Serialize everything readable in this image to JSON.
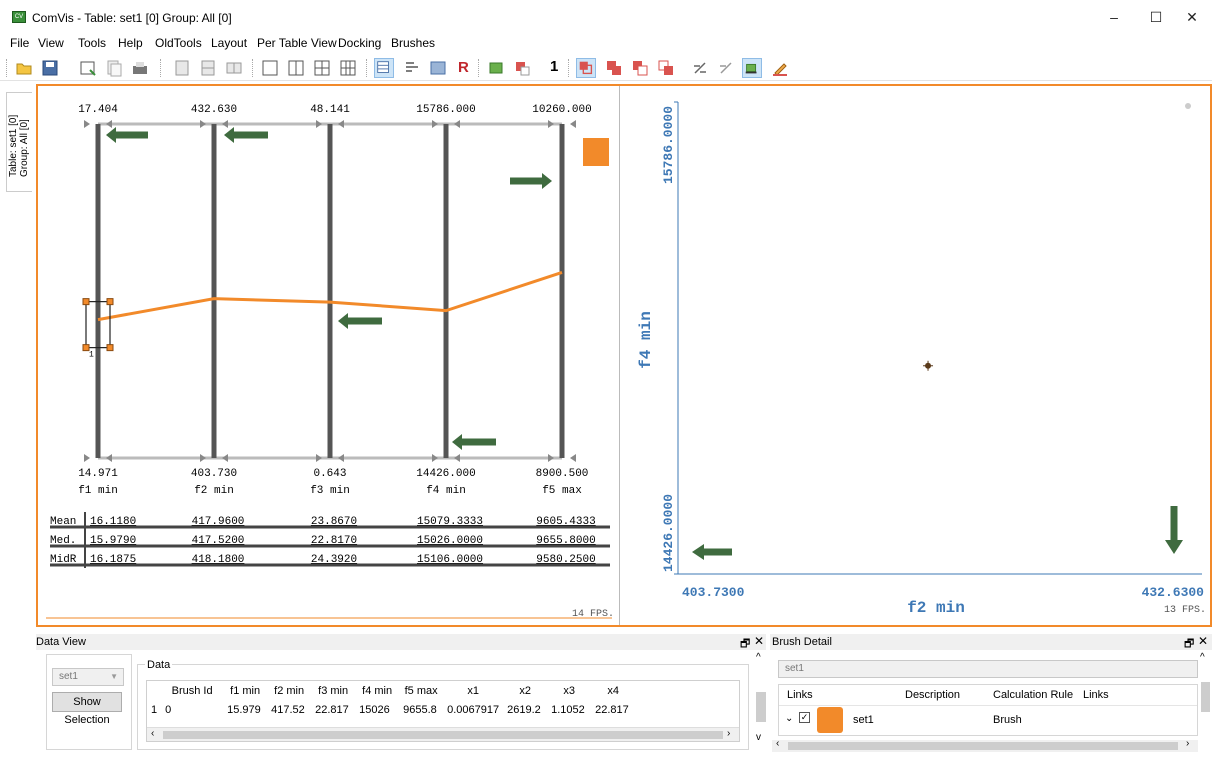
{
  "window": {
    "title": "ComVis - Table: set1 [0] Group: All [0]",
    "icon_text": "CV",
    "minimize": "–",
    "maximize": "☐",
    "close": "✕"
  },
  "menu": [
    "File",
    "View",
    "Tools",
    "Help",
    "OldTools",
    "Layout",
    "Per Table View",
    "Docking",
    "Brushes"
  ],
  "toolbar": {
    "r_label": "R",
    "one_label": "1",
    "icons": [
      "open-icon",
      "save-icon",
      "new-view-icon",
      "copy-icon",
      "print-icon",
      "layout-a-icon",
      "layout-b-icon",
      "layout-c-icon",
      "single-view-icon",
      "split-vertical-icon",
      "grid-four-icon",
      "grid-six-icon",
      "table-view-icon",
      "text-view-icon",
      "screenshot-icon",
      "r-icon",
      "plugin-icon",
      "brush-add-icon",
      "one-icon",
      "brush-and-icon",
      "brush-or-icon",
      "brush-xor-icon",
      "brush-not-icon",
      "brush-link-icon",
      "brush-unlink-icon",
      "clear-brush-icon",
      "brush-color-icon"
    ]
  },
  "sidetab": {
    "line1": "Table: set1 [0]",
    "line2": "Group: All [0]"
  },
  "parallel_coords": {
    "axes": [
      {
        "name": "f1 min",
        "max": "17.404",
        "min": "14.971"
      },
      {
        "name": "f2 min",
        "max": "432.630",
        "min": "403.730"
      },
      {
        "name": "f3 min",
        "max": "48.141",
        "min": "0.643"
      },
      {
        "name": "f4 min",
        "max": "15786.000",
        "min": "14426.000"
      },
      {
        "name": "f5 max",
        "max": "10260.000",
        "min": "8900.500"
      }
    ],
    "line_values": [
      15.979,
      417.52,
      22.817,
      15026,
      9655.8
    ],
    "brush_label": "1",
    "line_color": "#f28a2a",
    "stats": [
      {
        "label": "Mean",
        "values": [
          "16.1180",
          "417.9600",
          "23.8670",
          "15079.3333",
          "9605.4333"
        ]
      },
      {
        "label": "Med.",
        "values": [
          "15.9790",
          "417.5200",
          "22.8170",
          "15026.0000",
          "9655.8000"
        ]
      },
      {
        "label": "MidR",
        "values": [
          "16.1875",
          "418.1800",
          "24.3920",
          "15106.0000",
          "9580.2500"
        ]
      }
    ],
    "fps": "14 FPS."
  },
  "scatter": {
    "chart_data": {
      "type": "scatter",
      "xlabel": "f2 min",
      "ylabel": "f4 min",
      "xlim": [
        403.73,
        432.63
      ],
      "ylim": [
        14426,
        15786
      ],
      "x_tick_min": "403.7300",
      "x_tick_max": "432.6300",
      "y_tick_min": "14426.0000",
      "y_tick_max": "15786.0000",
      "points": [
        {
          "x": 417.52,
          "y": 15026
        }
      ]
    },
    "fps": "13 FPS."
  },
  "data_view": {
    "title": "Data View",
    "table_select": "set1",
    "show_selection": "Show Selection",
    "group_label": "Data",
    "columns": [
      "Brush Id",
      "f1 min",
      "f2 min",
      "f3 min",
      "f4 min",
      "f5 max",
      "x1",
      "x2",
      "x3",
      "x4"
    ],
    "rows": [
      {
        "index": "1",
        "cells": [
          "0",
          "15.979",
          "417.52",
          "22.817",
          "15026",
          "9655.8",
          "0.0067917",
          "2619.2",
          "1.1052",
          "22.817"
        ]
      }
    ]
  },
  "brush_detail": {
    "title": "Brush Detail",
    "table_select": "set1",
    "columns": [
      "Links",
      "Description",
      "Calculation Rule",
      "Links"
    ],
    "row": {
      "name": "set1",
      "rule": "Brush",
      "color": "#f28a2a"
    }
  },
  "annotation_color": "#3f6b3f"
}
